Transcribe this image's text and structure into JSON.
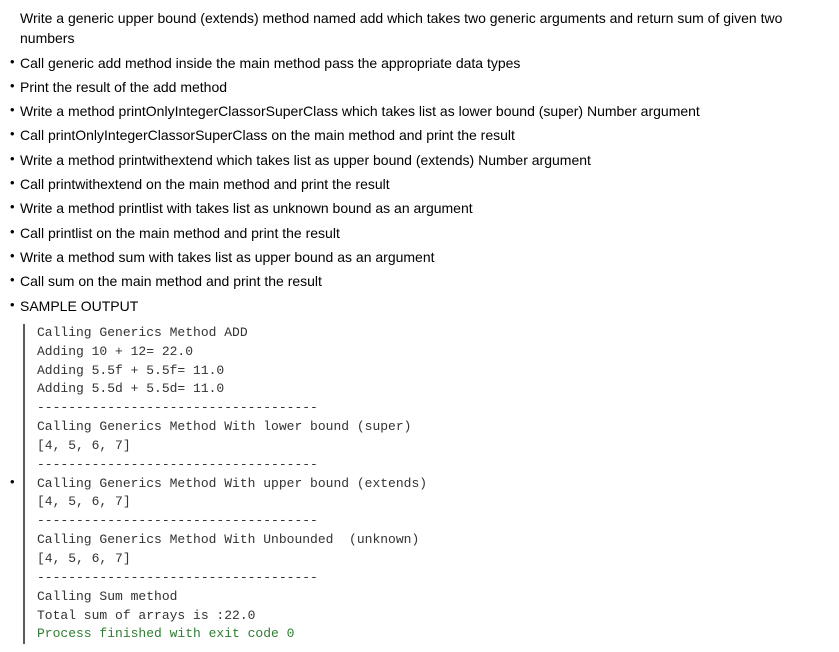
{
  "firstLine": "Write a generic upper bound (extends) method named add which takes two generic arguments and return sum of given two numbers",
  "bullets": [
    "Call generic add method inside the main method pass the appropriate data types",
    "Print the result of the add method",
    "Write a method printOnlyIntegerClassorSuperClass which takes list as lower bound (super) Number argument",
    "Call printOnlyIntegerClassorSuperClass on the main method and print the result",
    "Write a method printwithextend which takes list as upper bound (extends) Number argument",
    "Call printwithextend on the main method and print the result",
    "Write a method printlist with takes list as unknown bound as an argument",
    "Call printlist on the main method and print the result",
    "Write a method sum with takes list as upper bound as an argument",
    "Call sum on the main method and print the result",
    "SAMPLE OUTPUT"
  ],
  "output": {
    "lines": [
      "Calling Generics Method ADD",
      "Adding 10 + 12= 22.0",
      "Adding 5.5f + 5.5f= 11.0",
      "Adding 5.5d + 5.5d= 11.0",
      "------------------------------------",
      "Calling Generics Method With lower bound (super)",
      "[4, 5, 6, 7]",
      "------------------------------------",
      "Calling Generics Method With upper bound (extends)",
      "[4, 5, 6, 7]",
      "------------------------------------",
      "Calling Generics Method With Unbounded  (unknown)",
      "[4, 5, 6, 7]",
      "------------------------------------",
      "Calling Sum method",
      "Total sum of arrays is :22.0"
    ],
    "exitLine": "Process finished with exit code 0"
  }
}
